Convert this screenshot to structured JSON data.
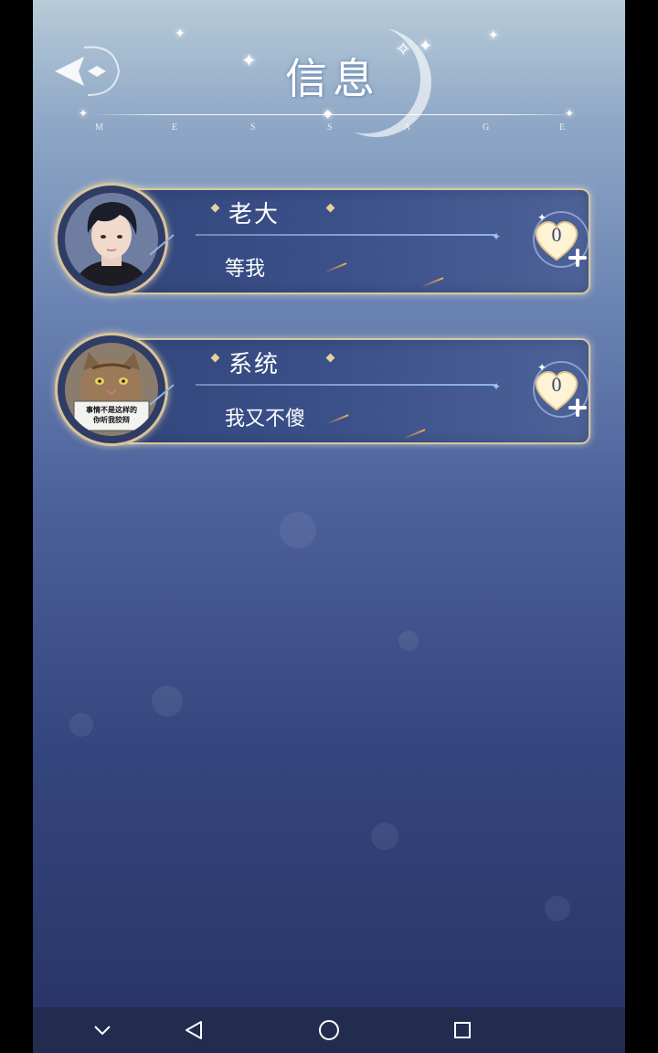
{
  "header": {
    "title": "信息",
    "subtitle_letters": [
      "M",
      "E",
      "S",
      "S",
      "A",
      "G",
      "E"
    ]
  },
  "conversations": [
    {
      "name": "老大",
      "last_message": "等我",
      "heart_count": "0",
      "avatar": "dark-haired-man-portrait"
    },
    {
      "name": "系统",
      "last_message": "我又不傻",
      "heart_count": "0",
      "avatar": "cat-meme",
      "avatar_caption_1": "事情不是这样的",
      "avatar_caption_2": "你听我狡辩"
    }
  ],
  "colors": {
    "card_border": "#d8c7a0",
    "card_fill": "#3b5089",
    "navbar": "#222c4f"
  },
  "icons": {
    "back": "back-arrow-icon",
    "heart": "heart-plus-icon",
    "nav": [
      "chevron-down-icon",
      "back-triangle-icon",
      "home-circle-icon",
      "recents-square-icon"
    ]
  }
}
